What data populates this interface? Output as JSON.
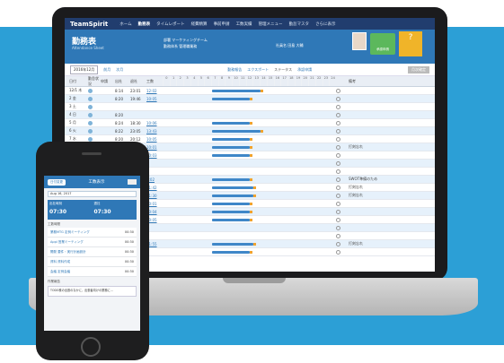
{
  "app": {
    "logo": "TeamSpirit"
  },
  "nav": [
    "ホーム",
    "勤務表",
    "タイムレポート",
    "経費精算",
    "事前申請",
    "工数実績",
    "管理メニュー",
    "勤怠マスタ",
    "さらに表示"
  ],
  "header": {
    "title": "勤務表",
    "subtitle": "Attendance Sheet",
    "dept_label": "部署",
    "dept": "マーケティングチーム",
    "type_label": "勤務体系",
    "type": "管理職業務",
    "emp_label": "社員名",
    "emp": "田島 大輔",
    "green_button": "承認申請",
    "yellow_icon": "?"
  },
  "toolbar": {
    "month": "2016年12月",
    "prev": "前月",
    "next": "次月",
    "items": [
      "勤務報告",
      "エクスポート",
      "ステータス",
      "承認申請"
    ],
    "grey_btn": "月次確定"
  },
  "columns": [
    "日付",
    "勤怠状況",
    "申請",
    "出社",
    "退社",
    "工数"
  ],
  "hours": [
    "0",
    "1",
    "2",
    "3",
    "4",
    "5",
    "6",
    "7",
    "8",
    "9",
    "10",
    "11",
    "12",
    "13",
    "14",
    "15",
    "16",
    "17",
    "18",
    "19",
    "20",
    "21",
    "22",
    "23",
    "24"
  ],
  "remarks_header": "備考",
  "rows": [
    {
      "date": "12/1 木",
      "in": "8:14",
      "out": "23:01",
      "wk": "12:02",
      "bar": [
        0.57,
        0.28
      ],
      "rm": ""
    },
    {
      "date": "2 金",
      "in": "8:20",
      "out": "19:46",
      "wk": "10:05",
      "bar": [
        0.57,
        0.22
      ],
      "rm": ""
    },
    {
      "date": "3 土",
      "in": "",
      "out": "",
      "wk": "",
      "bar": null,
      "rm": ""
    },
    {
      "date": "4 日",
      "in": "8:20",
      "out": "",
      "wk": "",
      "bar": null,
      "rm": ""
    },
    {
      "date": "5 月",
      "in": "8:24",
      "out": "18:30",
      "wk": "10:06",
      "bar": [
        0.57,
        0.22
      ],
      "rm": ""
    },
    {
      "date": "6 火",
      "in": "8:22",
      "out": "23:05",
      "wk": "13:43",
      "bar": [
        0.57,
        0.28
      ],
      "rm": ""
    },
    {
      "date": "7 水",
      "in": "8:20",
      "out": "20:12",
      "wk": "10:05",
      "bar": [
        0.57,
        0.22
      ],
      "rm": ""
    },
    {
      "date": "8 木",
      "in": "",
      "out": "20:00",
      "wk": "10:01",
      "bar": [
        0.57,
        0.22
      ],
      "rm": "打刻忘れ"
    },
    {
      "date": "9 金",
      "in": "",
      "out": "19:48",
      "wk": "10:03",
      "bar": [
        0.57,
        0.22
      ],
      "rm": ""
    },
    {
      "date": "10 土",
      "in": "",
      "out": "",
      "wk": "",
      "bar": null,
      "rm": ""
    },
    {
      "date": "11 日",
      "in": "",
      "out": "",
      "wk": "",
      "bar": null,
      "rm": ""
    },
    {
      "date": "12 月",
      "in": "",
      "out": "14:16",
      "wk": "5:02",
      "bar": [
        0.57,
        0.22
      ],
      "rm": "SWOT準備のため"
    },
    {
      "date": "13 火",
      "in": "",
      "out": "21:00",
      "wk": "11:42",
      "bar": [
        0.57,
        0.24
      ],
      "rm": "打刻忘れ"
    },
    {
      "date": "14 水",
      "in": "",
      "out": "21:00",
      "wk": "11:30",
      "bar": [
        0.57,
        0.24
      ],
      "rm": "打刻忘れ"
    },
    {
      "date": "15 木",
      "in": "",
      "out": "19:00",
      "wk": "10:01",
      "bar": [
        0.57,
        0.22
      ],
      "rm": ""
    },
    {
      "date": "16 金",
      "in": "",
      "out": "19:03",
      "wk": "10:04",
      "bar": [
        0.57,
        0.22
      ],
      "rm": ""
    },
    {
      "date": "17 土",
      "in": "",
      "out": "18:50",
      "wk": "10:05",
      "bar": [
        0.57,
        0.22
      ],
      "rm": ""
    },
    {
      "date": "18 日",
      "in": "",
      "out": "",
      "wk": "",
      "bar": null,
      "rm": ""
    },
    {
      "date": "19 月",
      "in": "",
      "out": "",
      "wk": "",
      "bar": null,
      "rm": ""
    },
    {
      "date": "20 火",
      "in": "",
      "out": "22:00",
      "wk": "11:55",
      "bar": [
        0.57,
        0.24
      ],
      "rm": "打刻忘れ"
    },
    {
      "date": "21 水",
      "in": "",
      "out": "19:23",
      "wk": "",
      "bar": [
        0.57,
        0.22
      ],
      "rm": ""
    }
  ],
  "phone": {
    "pill": "日付変更",
    "title": "工数表示",
    "date": "Aug 16, 2017",
    "in_label": "出社時刻",
    "in": "07:30",
    "out_label": "退社",
    "out": "07:30",
    "section": "工数時間",
    "items": [
      {
        "name": "業務MTG 定例ミーティング",
        "val": "00:30"
      },
      {
        "name": "Appl 営業ミーティング",
        "val": "00:30"
      },
      {
        "name": "開発 要件・実行計画設計",
        "val": "00:30"
      },
      {
        "name": "資料 資料作成",
        "val": "00:30"
      },
      {
        "name": "会議 定例会議",
        "val": "00:30"
      }
    ],
    "note_label": "作業報告",
    "note": "TODO株の出張のなかに、出張者向けの業務に..."
  }
}
